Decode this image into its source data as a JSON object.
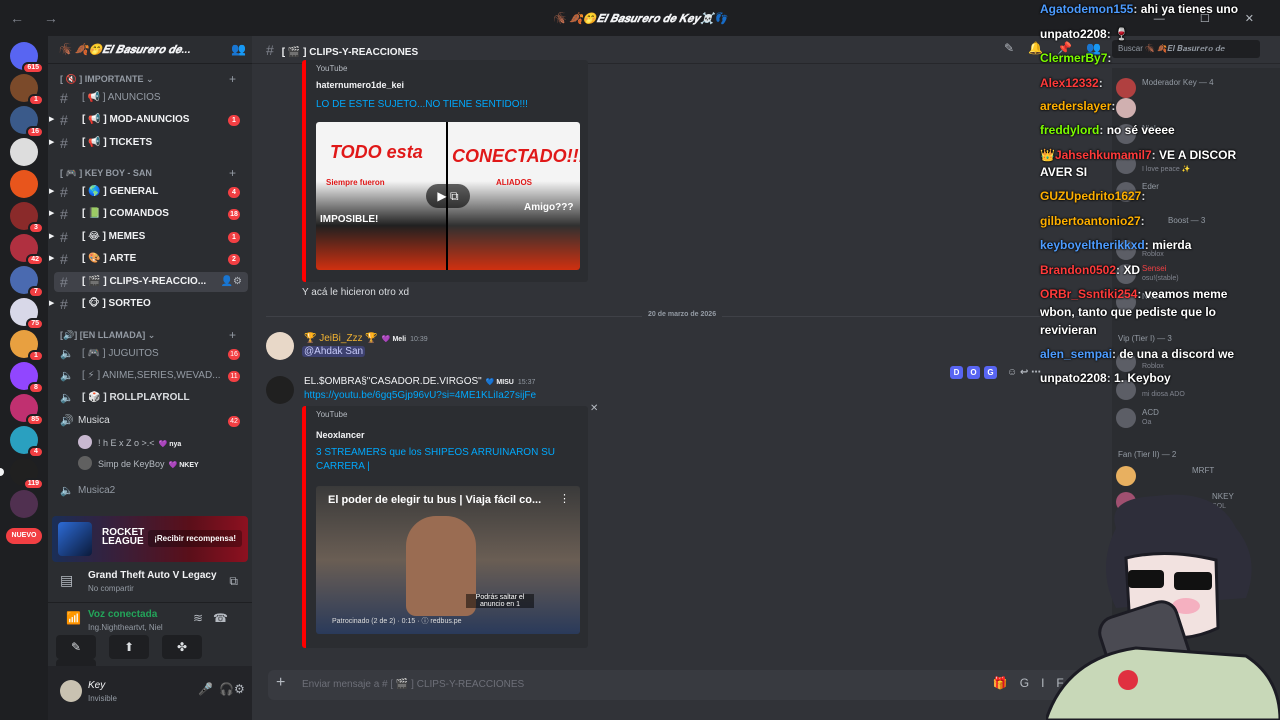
{
  "window": {
    "title": "🪳 🍂🤭𝑬𝒍 𝑩𝒂𝒔𝒖𝒓𝒆𝒓𝒐 𝒅𝒆 𝑲𝒆𝒚☠️👣"
  },
  "guilds": [
    {
      "badge": "615"
    },
    {
      "badge": "1"
    },
    {
      "badge": "16"
    },
    {
      "badge": ""
    },
    {
      "badge": ""
    },
    {
      "badge": "3"
    },
    {
      "badge": "42"
    },
    {
      "badge": "7"
    },
    {
      "badge": "75"
    },
    {
      "badge": "1"
    },
    {
      "badge": "8"
    },
    {
      "badge": "85"
    },
    {
      "badge": "4"
    },
    {
      "badge": "119"
    },
    {
      "badge": ""
    }
  ],
  "guilds_new_label": "NUEVO",
  "server": {
    "name": "🪳 🍂🤭𝑬𝒍 𝑩𝒂𝒔𝒖𝒓𝒆𝒓𝒐 𝒅𝒆..."
  },
  "categories": {
    "importante": "[ 🔇 ] IMPORTANTE",
    "keyboy": "[ 🎮 ] KEY BOY - SAN",
    "llamada": "[🔊] [EN LLAMADA]"
  },
  "channels": [
    {
      "label": "[ 📢 ] ANUNCIOS",
      "count": ""
    },
    {
      "label": "[ 📢 ] MOD-ANUNCIOS",
      "count": "1"
    },
    {
      "label": "[ 📢 ] TICKETS",
      "count": ""
    },
    {
      "label": "[ 🌎 ] GENERAL",
      "count": "4"
    },
    {
      "label": "[ 📗 ] COMANDOS",
      "count": "18"
    },
    {
      "label": "[ 😂 ] MEMES",
      "count": "1"
    },
    {
      "label": "[ 🎨 ] ARTE",
      "count": "2"
    },
    {
      "label": "[ 🎬 ] CLIPS-Y-REACCIO...",
      "count": ""
    },
    {
      "label": "[ 🐵 ] SORTEO",
      "count": ""
    }
  ],
  "voice_channels": [
    {
      "label": "[ 🎮 ] JUGUITOS",
      "count": "16"
    },
    {
      "label": "[ ⚡ ] ANIME,SERIES,WEVAD...",
      "count": "11"
    },
    {
      "label": "[ 🎲 ] ROLLPLAYROLL",
      "count": ""
    },
    {
      "label": "Musica",
      "count": "42"
    }
  ],
  "voice_users": [
    {
      "name": "! h E x Z o >.<",
      "tag": "💜 nya"
    },
    {
      "name": "Simp de KeyBoy",
      "tag": "💜 NKEY"
    }
  ],
  "voice_channel_extra": "Musica2",
  "promo": {
    "logo": "ROCKET LEAGUE",
    "button": "¡Recibir recompensa!"
  },
  "activity": {
    "game": "Grand Theft Auto V Legacy",
    "sub": "No compartir"
  },
  "voice_status": {
    "title": "Voz conectada",
    "sub": "Ing.Nightheartvt, Niel"
  },
  "user": {
    "name": "Key",
    "status": "Invisible"
  },
  "chat": {
    "channel": "[ 🎬 ] CLIPS-Y-REACCIONES",
    "search_placeholder": "Buscar 🪳 🍂𝑬𝒍 𝑩𝒂𝒔𝒖𝒓𝒆𝒓𝒐 𝒅𝒆",
    "composer_placeholder": "Enviar mensaje a # [ 🎬 ] CLIPS-Y-REACCIONES"
  },
  "embed1": {
    "provider": "YouTube",
    "author": "haternumero1de_kei",
    "title": "LO DE ESTE SUJETO...NO TIENE SENTIDO!!!",
    "thumb_left": "TODO esta",
    "thumb_right": "CONECTADO!!!",
    "thumb_sub1": "Siempre fueron",
    "thumb_sub2": "ALIADOS",
    "thumb_imp": "IMPOSIBLE!",
    "thumb_amigo": "Amigo???"
  },
  "msg_after_embed1": "Y acá le hicieron otro xd",
  "date_divider": "20 de marzo de 2026",
  "msg2": {
    "author": "🏆 JeiBi_Zzz 🏆",
    "tag": "💜 Meli",
    "time": "10:39",
    "mention": "@Ahdak San"
  },
  "msg3": {
    "author": "EL.$OMBRA§\"CASADOR.DE.VIRGOS\"",
    "tag": "💙 MISU",
    "time": "15:37",
    "link": "https://youtu.be/6gq5Gjp96vU?si=4ME1KLiIa27sijFe"
  },
  "embed2": {
    "provider": "YouTube",
    "author": "Neoxlancer",
    "title_l1": "3 STREAMERS que los SHIPEOS ARRUINARON SU",
    "title_l2": "CARRERA |",
    "video_title": "El poder de elegir tu bus | Viaja fácil co...",
    "ad_text": "Patrocinado (2 de 2) · 0:15 · ⓘ redbus.pe",
    "skip": "Podrás saltar el anuncio en 1"
  },
  "hover_tools": [
    "D",
    "O",
    "G"
  ],
  "members": {
    "items": [
      {
        "name": "Moderador Key — 4",
        "sub": ""
      },
      {
        "name": "",
        "sub": ""
      },
      {
        "name": "Niel",
        "sub": ""
      },
      {
        "name": "",
        "sub": "I love peace ✨"
      },
      {
        "name": "Eder",
        "sub": ""
      },
      {
        "name": "Boost — 3",
        "sub": ""
      },
      {
        "name": "",
        "sub": "Roblox"
      },
      {
        "name": "Sensei",
        "sub": "osu!(stable)"
      },
      {
        "name": "NKEY",
        "sub": ""
      },
      {
        "name": "Vip (Tier I) — 3",
        "sub": ""
      },
      {
        "name": "",
        "sub": "Roblox"
      },
      {
        "name": "",
        "sub": "mi diosa ADO"
      },
      {
        "name": "ACD",
        "sub": "Oa"
      },
      {
        "name": "Fan (Tier II) — 2",
        "sub": ""
      },
      {
        "name": "MRFT",
        "sub": ""
      },
      {
        "name": "NKEY",
        "sub": "SOL"
      }
    ]
  },
  "overlay_chat": [
    {
      "user": "Agatodemon155",
      "color": "#4d9cff",
      "msg": "ahi ya tienes uno"
    },
    {
      "user": "unpato2208",
      "color": "#ffffff",
      "msg": "🍷"
    },
    {
      "user": "ClermerBy7",
      "color": "#7CFC00",
      "msg": ""
    },
    {
      "user": "Alex12332",
      "color": "#ff3b3b",
      "msg": ""
    },
    {
      "user": "arederslayer",
      "color": "#ffb000",
      "msg": ""
    },
    {
      "user": "freddylord",
      "color": "#7CFC00",
      "msg": "no sé veeee"
    },
    {
      "user": "👑Jahsehkumamil7",
      "color": "#ff3b3b",
      "msg": "VE A DISCOR"
    },
    {
      "user": "",
      "color": "#ffffff",
      "msg": "AVER SI"
    },
    {
      "user": "GUZUpedrito1627",
      "color": "#ffb000",
      "msg": ""
    },
    {
      "user": "gilbertoantonio27",
      "color": "#ffb000",
      "msg": ""
    },
    {
      "user": "keyboyeltherikkxd",
      "color": "#4d9cff",
      "msg": "mierda"
    },
    {
      "user": "Brandon0502",
      "color": "#ff3b3b",
      "msg": "XD"
    },
    {
      "user": "ORBr_Ssntiki254",
      "color": "#ff3b3b",
      "msg": "veamos meme"
    },
    {
      "user": "",
      "color": "#ffffff",
      "msg": "wbon, tanto que pediste que lo"
    },
    {
      "user": "",
      "color": "#ffffff",
      "msg": "revivieran"
    },
    {
      "user": "alen_sempai",
      "color": "#4d9cff",
      "msg": "de una a discord we"
    },
    {
      "user": "unpato2208",
      "color": "#ffffff",
      "msg": "1. Keyboy"
    }
  ],
  "colors": {
    "accent": "#5865f2",
    "danger": "#f23f43",
    "online": "#23a55a",
    "link": "#00a8fc",
    "youtube": "#ff0000"
  }
}
